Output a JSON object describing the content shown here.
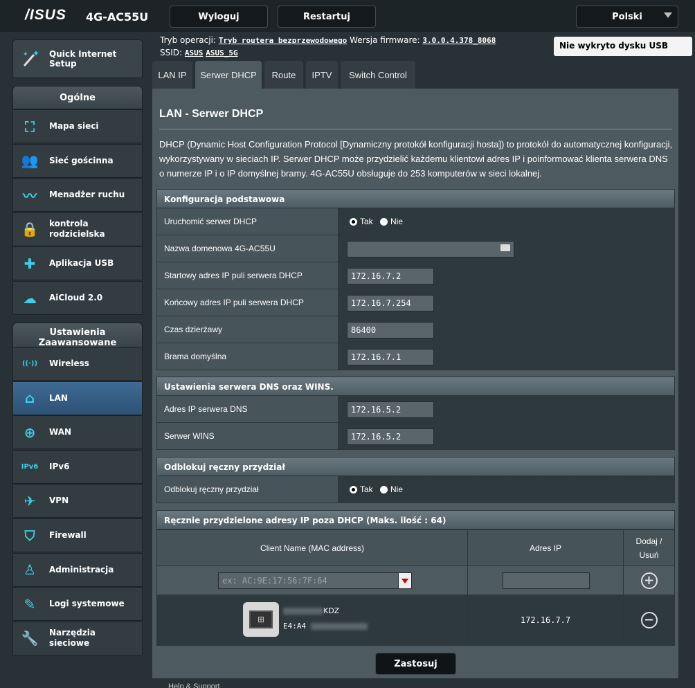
{
  "header": {
    "logo": "/ISUS",
    "model": "4G-AC55U",
    "logout": "Wyloguj",
    "restart": "Restartuj",
    "language": "Polski",
    "op_mode_label": "Tryb operacji:",
    "op_mode_value": "Tryb routera bezprzewodowego",
    "firmware_label": "Wersja firmware:",
    "firmware_value": "3.0.0.4.378_8068",
    "ssid_label": "SSID:",
    "ssid_1": "ASUS",
    "ssid_2": "ASUS_5G",
    "usb_status": "Nie wykryto dysku USB"
  },
  "sidebar": {
    "quick_setup": "Quick Internet Setup",
    "general_header": "Ogólne",
    "general_items": [
      {
        "label": "Mapa sieci",
        "icon": "network-map-icon"
      },
      {
        "label": "Sieć gościnna",
        "icon": "guest-network-icon"
      },
      {
        "label": "Menadżer ruchu",
        "icon": "traffic-manager-icon"
      },
      {
        "label": "kontrola rodzicielska",
        "icon": "lock-icon"
      },
      {
        "label": "Aplikacja USB",
        "icon": "puzzle-icon"
      },
      {
        "label": "AiCloud 2.0",
        "icon": "cloud-icon"
      }
    ],
    "advanced_header": "Ustawienia Zaawansowane",
    "advanced_items": [
      {
        "label": "Wireless",
        "icon": "wifi-icon"
      },
      {
        "label": "LAN",
        "icon": "home-icon"
      },
      {
        "label": "WAN",
        "icon": "globe-icon"
      },
      {
        "label": "IPv6",
        "icon": "ipv6-icon"
      },
      {
        "label": "VPN",
        "icon": "vpn-icon"
      },
      {
        "label": "Firewall",
        "icon": "shield-icon"
      },
      {
        "label": "Administracja",
        "icon": "admin-user-icon"
      },
      {
        "label": "Logi systemowe",
        "icon": "log-icon"
      },
      {
        "label": "Narzędzia sieciowe",
        "icon": "tools-icon"
      }
    ]
  },
  "tabs": [
    "LAN IP",
    "Serwer DHCP",
    "Route",
    "IPTV",
    "Switch Control"
  ],
  "page": {
    "title": "LAN - Serwer DHCP",
    "description": "DHCP (Dynamic Host Configuration Protocol [Dynamiczny protokół konfiguracji hosta]) to protokół do automatycznej konfiguracji, wykorzystywany w sieciach IP. Serwer DHCP może przydzielić każdemu klientowi adres IP i poinformować klienta serwera DNS o numerze IP i o IP domyślnej bramy. 4G-AC55U obsługuje do 253 komputerów w sieci lokalnej."
  },
  "basic": {
    "header": "Konfiguracja podstawowa",
    "enable_label": "Uruchomić serwer DHCP",
    "yes": "Tak",
    "no": "Nie",
    "domain_label": "Nazwa domenowa 4G-AC55U",
    "domain_value": "",
    "start_label": "Startowy adres IP puli serwera DHCP",
    "start_value": "172.16.7.2",
    "end_label": "Końcowy adres IP puli serwera DHCP",
    "end_value": "172.16.7.254",
    "lease_label": "Czas dzierżawy",
    "lease_value": "86400",
    "gateway_label": "Brama domyślna",
    "gateway_value": "172.16.7.1"
  },
  "dns": {
    "header": "Ustawienia serwera DNS oraz WINS.",
    "dns_label": "Adres IP serwera DNS",
    "dns_value": "172.16.5.2",
    "wins_label": "Serwer WINS",
    "wins_value": "172.16.5.2"
  },
  "manual": {
    "header": "Odblokuj ręczny przydział",
    "label": "Odblokuj ręczny przydział",
    "yes": "Tak",
    "no": "Nie"
  },
  "static_list": {
    "header": "Ręcznie przydzielone adresy IP poza DHCP (Maks. ilość : 64)",
    "col_client": "Client Name (MAC address)",
    "col_ip": "Adres IP",
    "col_action": "Dodaj / Usuń",
    "mac_placeholder": "ex: AC:9E:17:56:7F:64",
    "ip_placeholder": "",
    "entries": [
      {
        "name_suffix": "KDZ",
        "mac_prefix": "E4:A4",
        "ip": "172.16.7.7"
      }
    ]
  },
  "apply": "Zastosuj",
  "footer": "Help & Support"
}
